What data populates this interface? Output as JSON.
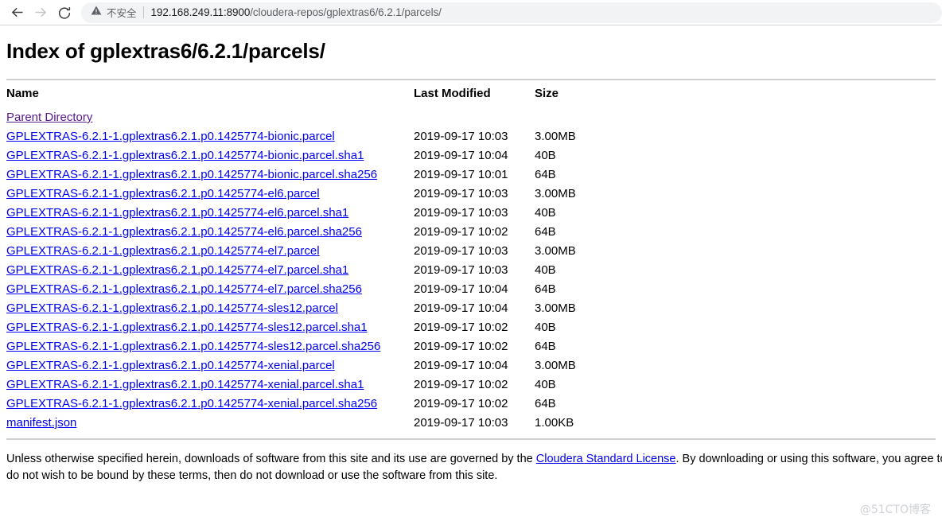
{
  "browser": {
    "back_icon": "arrow-left-icon",
    "forward_icon": "arrow-right-icon",
    "reload_icon": "reload-icon",
    "security_icon": "warning-triangle-icon",
    "security_label": "不安全",
    "url_host": "192.168.249.11:8900",
    "url_path": "/cloudera-repos/gplextras6/6.2.1/parcels/",
    "url_full": "192.168.249.11:8900/cloudera-repos/gplextras6/6.2.1/parcels/"
  },
  "page": {
    "title": "Index of gplextras6/6.2.1/parcels/",
    "columns": {
      "name": "Name",
      "last_modified": "Last Modified",
      "size": "Size"
    },
    "parent_directory": "Parent Directory",
    "rows": [
      {
        "name": "GPLEXTRAS-6.2.1-1.gplextras6.2.1.p0.1425774-bionic.parcel",
        "modified": "2019-09-17 10:03",
        "size": "3.00MB"
      },
      {
        "name": "GPLEXTRAS-6.2.1-1.gplextras6.2.1.p0.1425774-bionic.parcel.sha1",
        "modified": "2019-09-17 10:04",
        "size": "40B"
      },
      {
        "name": "GPLEXTRAS-6.2.1-1.gplextras6.2.1.p0.1425774-bionic.parcel.sha256",
        "modified": "2019-09-17 10:01",
        "size": "64B"
      },
      {
        "name": "GPLEXTRAS-6.2.1-1.gplextras6.2.1.p0.1425774-el6.parcel",
        "modified": "2019-09-17 10:03",
        "size": "3.00MB"
      },
      {
        "name": "GPLEXTRAS-6.2.1-1.gplextras6.2.1.p0.1425774-el6.parcel.sha1",
        "modified": "2019-09-17 10:03",
        "size": "40B"
      },
      {
        "name": "GPLEXTRAS-6.2.1-1.gplextras6.2.1.p0.1425774-el6.parcel.sha256",
        "modified": "2019-09-17 10:02",
        "size": "64B"
      },
      {
        "name": "GPLEXTRAS-6.2.1-1.gplextras6.2.1.p0.1425774-el7.parcel",
        "modified": "2019-09-17 10:03",
        "size": "3.00MB"
      },
      {
        "name": "GPLEXTRAS-6.2.1-1.gplextras6.2.1.p0.1425774-el7.parcel.sha1",
        "modified": "2019-09-17 10:03",
        "size": "40B"
      },
      {
        "name": "GPLEXTRAS-6.2.1-1.gplextras6.2.1.p0.1425774-el7.parcel.sha256",
        "modified": "2019-09-17 10:04",
        "size": "64B"
      },
      {
        "name": "GPLEXTRAS-6.2.1-1.gplextras6.2.1.p0.1425774-sles12.parcel",
        "modified": "2019-09-17 10:04",
        "size": "3.00MB"
      },
      {
        "name": "GPLEXTRAS-6.2.1-1.gplextras6.2.1.p0.1425774-sles12.parcel.sha1",
        "modified": "2019-09-17 10:02",
        "size": "40B"
      },
      {
        "name": "GPLEXTRAS-6.2.1-1.gplextras6.2.1.p0.1425774-sles12.parcel.sha256",
        "modified": "2019-09-17 10:02",
        "size": "64B"
      },
      {
        "name": "GPLEXTRAS-6.2.1-1.gplextras6.2.1.p0.1425774-xenial.parcel",
        "modified": "2019-09-17 10:04",
        "size": "3.00MB"
      },
      {
        "name": "GPLEXTRAS-6.2.1-1.gplextras6.2.1.p0.1425774-xenial.parcel.sha1",
        "modified": "2019-09-17 10:02",
        "size": "40B"
      },
      {
        "name": "GPLEXTRAS-6.2.1-1.gplextras6.2.1.p0.1425774-xenial.parcel.sha256",
        "modified": "2019-09-17 10:02",
        "size": "64B"
      },
      {
        "name": "manifest.json",
        "modified": "2019-09-17 10:03",
        "size": "1.00KB"
      }
    ]
  },
  "footer": {
    "text_before_link": "Unless otherwise specified herein, downloads of software from this site and its use are governed by the ",
    "link_label": "Cloudera Standard License",
    "text_after_link": ". By downloading or using this software, you agree to be bound by these terms. If you do not wish to be bound by these terms, then do not download or use the software from this site."
  },
  "watermark": "@51CTO博客",
  "colors": {
    "link": "#0000ee",
    "visited_link": "#551a8b",
    "omnibox_bg": "#f1f3f4",
    "rule": "#cfcfcf",
    "watermark": "#cfd2d6"
  }
}
